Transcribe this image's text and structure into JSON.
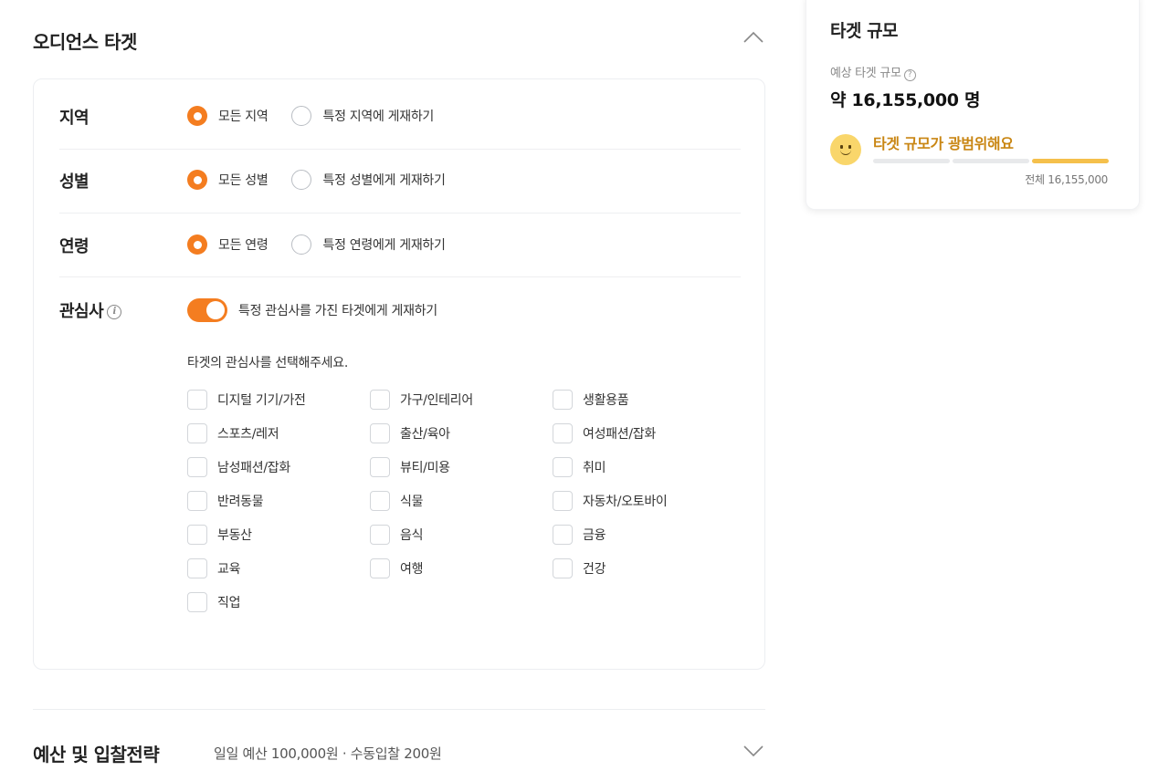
{
  "audience": {
    "title": "오디언스 타겟",
    "rows": [
      {
        "label": "지역",
        "options": [
          {
            "label": "모든 지역",
            "checked": true
          },
          {
            "label": "특정 지역에 게재하기",
            "checked": false
          }
        ]
      },
      {
        "label": "성별",
        "options": [
          {
            "label": "모든 성별",
            "checked": true
          },
          {
            "label": "특정 성별에게 게재하기",
            "checked": false
          }
        ]
      },
      {
        "label": "연령",
        "options": [
          {
            "label": "모든 연령",
            "checked": true
          },
          {
            "label": "특정 연령에게 게재하기",
            "checked": false
          }
        ]
      }
    ],
    "interest": {
      "label": "관심사",
      "info_icon": "i",
      "toggle_on": true,
      "toggle_label": "특정 관심사를 가진 타겟에게 게재하기",
      "prompt": "타겟의 관심사를 선택해주세요.",
      "items": [
        "디지털 기기/가전",
        "가구/인테리어",
        "생활용품",
        "스포츠/레저",
        "출산/육아",
        "여성패션/잡화",
        "남성패션/잡화",
        "뷰티/미용",
        "취미",
        "반려동물",
        "식물",
        "자동차/오토바이",
        "부동산",
        "음식",
        "금융",
        "교육",
        "여행",
        "건강",
        "직업"
      ]
    }
  },
  "budget": {
    "title": "예산 및 입찰전략",
    "summary": "일일 예산 100,000원 · 수동입찰 200원"
  },
  "side": {
    "title": "타겟 규모",
    "estimate_label": "예상 타겟 규모",
    "help_icon": "?",
    "size": "약 16,155,000 명",
    "breadth": "타겟 규모가 광범위해요",
    "breadth_level": 3,
    "breadth_levels": 3,
    "total": "전체 16,155,000"
  },
  "colors": {
    "accent": "#f47d20",
    "breadth_text": "#c98613",
    "breadth_bar": "#f5c04c",
    "smiley": "#f9d66b"
  },
  "icons": {
    "collapse": "chevron-up-icon",
    "expand": "chevron-down-icon",
    "info": "info-icon",
    "help": "question-circle-icon",
    "mood": "smiley-face-icon"
  }
}
